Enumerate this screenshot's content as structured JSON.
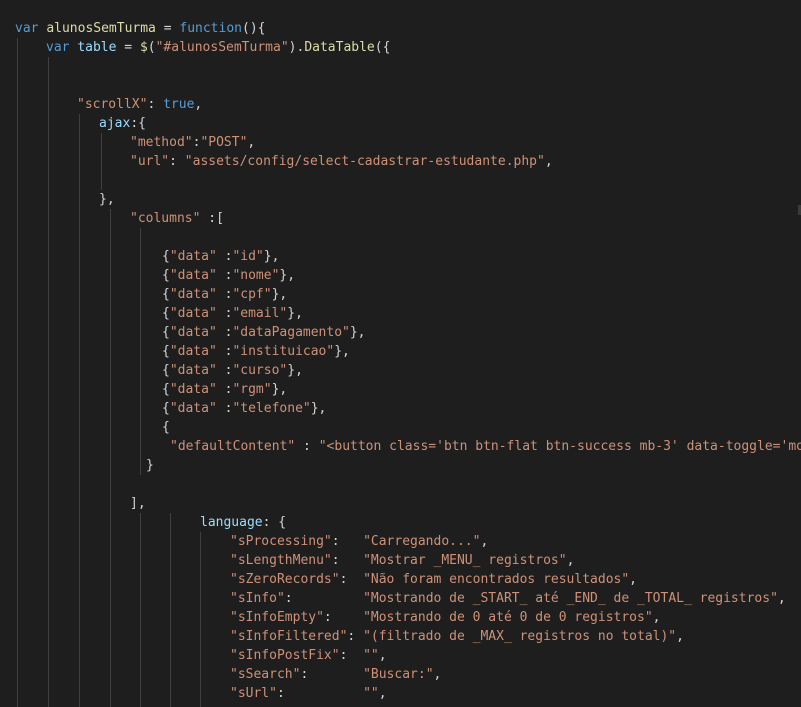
{
  "lines": [
    [
      [
        "kw",
        "var "
      ],
      [
        "fn",
        "alunosSemTurma"
      ],
      [
        "pn",
        " = "
      ],
      [
        "kw",
        "function"
      ],
      [
        "pn",
        "(){"
      ]
    ],
    [
      [
        "kw",
        "var "
      ],
      [
        "var",
        "table"
      ],
      [
        "pn",
        " = "
      ],
      [
        "fn",
        "$"
      ],
      [
        "pn",
        "("
      ],
      [
        "str",
        "\"#alunosSemTurma\""
      ],
      [
        "pn",
        ")."
      ],
      [
        "fn",
        "DataTable"
      ],
      [
        "pn",
        "({"
      ]
    ],
    [],
    [],
    [
      [
        "str",
        "\"scrollX\""
      ],
      [
        "pn",
        ": "
      ],
      [
        "kw",
        "true"
      ],
      [
        "pn",
        ","
      ]
    ],
    [
      [
        "key",
        "ajax"
      ],
      [
        "pn",
        ":{"
      ]
    ],
    [
      [
        "str",
        "\"method\""
      ],
      [
        "pn",
        ":"
      ],
      [
        "str",
        "\"POST\""
      ],
      [
        "pn",
        ","
      ]
    ],
    [
      [
        "str",
        "\"url\""
      ],
      [
        "pn",
        ": "
      ],
      [
        "str",
        "\"assets/config/select-cadastrar-estudante.php\""
      ],
      [
        "pn",
        ","
      ]
    ],
    [],
    [
      [
        "pn",
        "},"
      ]
    ],
    [
      [
        "str",
        "\"columns\""
      ],
      [
        "pn",
        " :["
      ]
    ],
    [],
    [
      [
        "pn",
        "{"
      ],
      [
        "str",
        "\"data\""
      ],
      [
        "pn",
        " :"
      ],
      [
        "str",
        "\"id\""
      ],
      [
        "pn",
        "},"
      ]
    ],
    [
      [
        "pn",
        "{"
      ],
      [
        "str",
        "\"data\""
      ],
      [
        "pn",
        " :"
      ],
      [
        "str",
        "\"nome\""
      ],
      [
        "pn",
        "},"
      ]
    ],
    [
      [
        "pn",
        "{"
      ],
      [
        "str",
        "\"data\""
      ],
      [
        "pn",
        " :"
      ],
      [
        "str",
        "\"cpf\""
      ],
      [
        "pn",
        "},"
      ]
    ],
    [
      [
        "pn",
        "{"
      ],
      [
        "str",
        "\"data\""
      ],
      [
        "pn",
        " :"
      ],
      [
        "str",
        "\"email\""
      ],
      [
        "pn",
        "},"
      ]
    ],
    [
      [
        "pn",
        "{"
      ],
      [
        "str",
        "\"data\""
      ],
      [
        "pn",
        " :"
      ],
      [
        "str",
        "\"dataPagamento\""
      ],
      [
        "pn",
        "},"
      ]
    ],
    [
      [
        "pn",
        "{"
      ],
      [
        "str",
        "\"data\""
      ],
      [
        "pn",
        " :"
      ],
      [
        "str",
        "\"instituicao\""
      ],
      [
        "pn",
        "},"
      ]
    ],
    [
      [
        "pn",
        "{"
      ],
      [
        "str",
        "\"data\""
      ],
      [
        "pn",
        " :"
      ],
      [
        "str",
        "\"curso\""
      ],
      [
        "pn",
        "},"
      ]
    ],
    [
      [
        "pn",
        "{"
      ],
      [
        "str",
        "\"data\""
      ],
      [
        "pn",
        " :"
      ],
      [
        "str",
        "\"rgm\""
      ],
      [
        "pn",
        "},"
      ]
    ],
    [
      [
        "pn",
        "{"
      ],
      [
        "str",
        "\"data\""
      ],
      [
        "pn",
        " :"
      ],
      [
        "str",
        "\"telefone\""
      ],
      [
        "pn",
        "},"
      ]
    ],
    [
      [
        "pn",
        "{"
      ]
    ],
    [
      [
        "str",
        "\"defaultContent\""
      ],
      [
        "pn",
        " : "
      ],
      [
        "str",
        "\"<button class='btn btn-flat btn-success mb-3' data-toggle='moc"
      ]
    ],
    [
      [
        "pn",
        "}"
      ]
    ],
    [],
    [
      [
        "pn",
        "],"
      ]
    ],
    [
      [
        "key",
        "language"
      ],
      [
        "pn",
        ": {"
      ]
    ],
    [
      [
        "str",
        "\"sProcessing\""
      ],
      [
        "pn",
        ":   "
      ],
      [
        "str",
        "\"Carregando...\""
      ],
      [
        "pn",
        ","
      ]
    ],
    [
      [
        "str",
        "\"sLengthMenu\""
      ],
      [
        "pn",
        ":   "
      ],
      [
        "str",
        "\"Mostrar _MENU_ registros\""
      ],
      [
        "pn",
        ","
      ]
    ],
    [
      [
        "str",
        "\"sZeroRecords\""
      ],
      [
        "pn",
        ":  "
      ],
      [
        "str",
        "\"Não foram encontrados resultados\""
      ],
      [
        "pn",
        ","
      ]
    ],
    [
      [
        "str",
        "\"sInfo\""
      ],
      [
        "pn",
        ":         "
      ],
      [
        "str",
        "\"Mostrando de _START_ até _END_ de _TOTAL_ registros\""
      ],
      [
        "pn",
        ","
      ]
    ],
    [
      [
        "str",
        "\"sInfoEmpty\""
      ],
      [
        "pn",
        ":    "
      ],
      [
        "str",
        "\"Mostrando de 0 até 0 de 0 registros\""
      ],
      [
        "pn",
        ","
      ]
    ],
    [
      [
        "str",
        "\"sInfoFiltered\""
      ],
      [
        "pn",
        ": "
      ],
      [
        "str",
        "\"(filtrado de _MAX_ registros no total)\""
      ],
      [
        "pn",
        ","
      ]
    ],
    [
      [
        "str",
        "\"sInfoPostFix\""
      ],
      [
        "pn",
        ":  "
      ],
      [
        "str",
        "\"\""
      ],
      [
        "pn",
        ","
      ]
    ],
    [
      [
        "str",
        "\"sSearch\""
      ],
      [
        "pn",
        ":       "
      ],
      [
        "str",
        "\"Buscar:\""
      ],
      [
        "pn",
        ","
      ]
    ],
    [
      [
        "str",
        "\"sUrl\""
      ],
      [
        "pn",
        ":          "
      ],
      [
        "str",
        "\"\""
      ],
      [
        "pn",
        ","
      ]
    ]
  ]
}
